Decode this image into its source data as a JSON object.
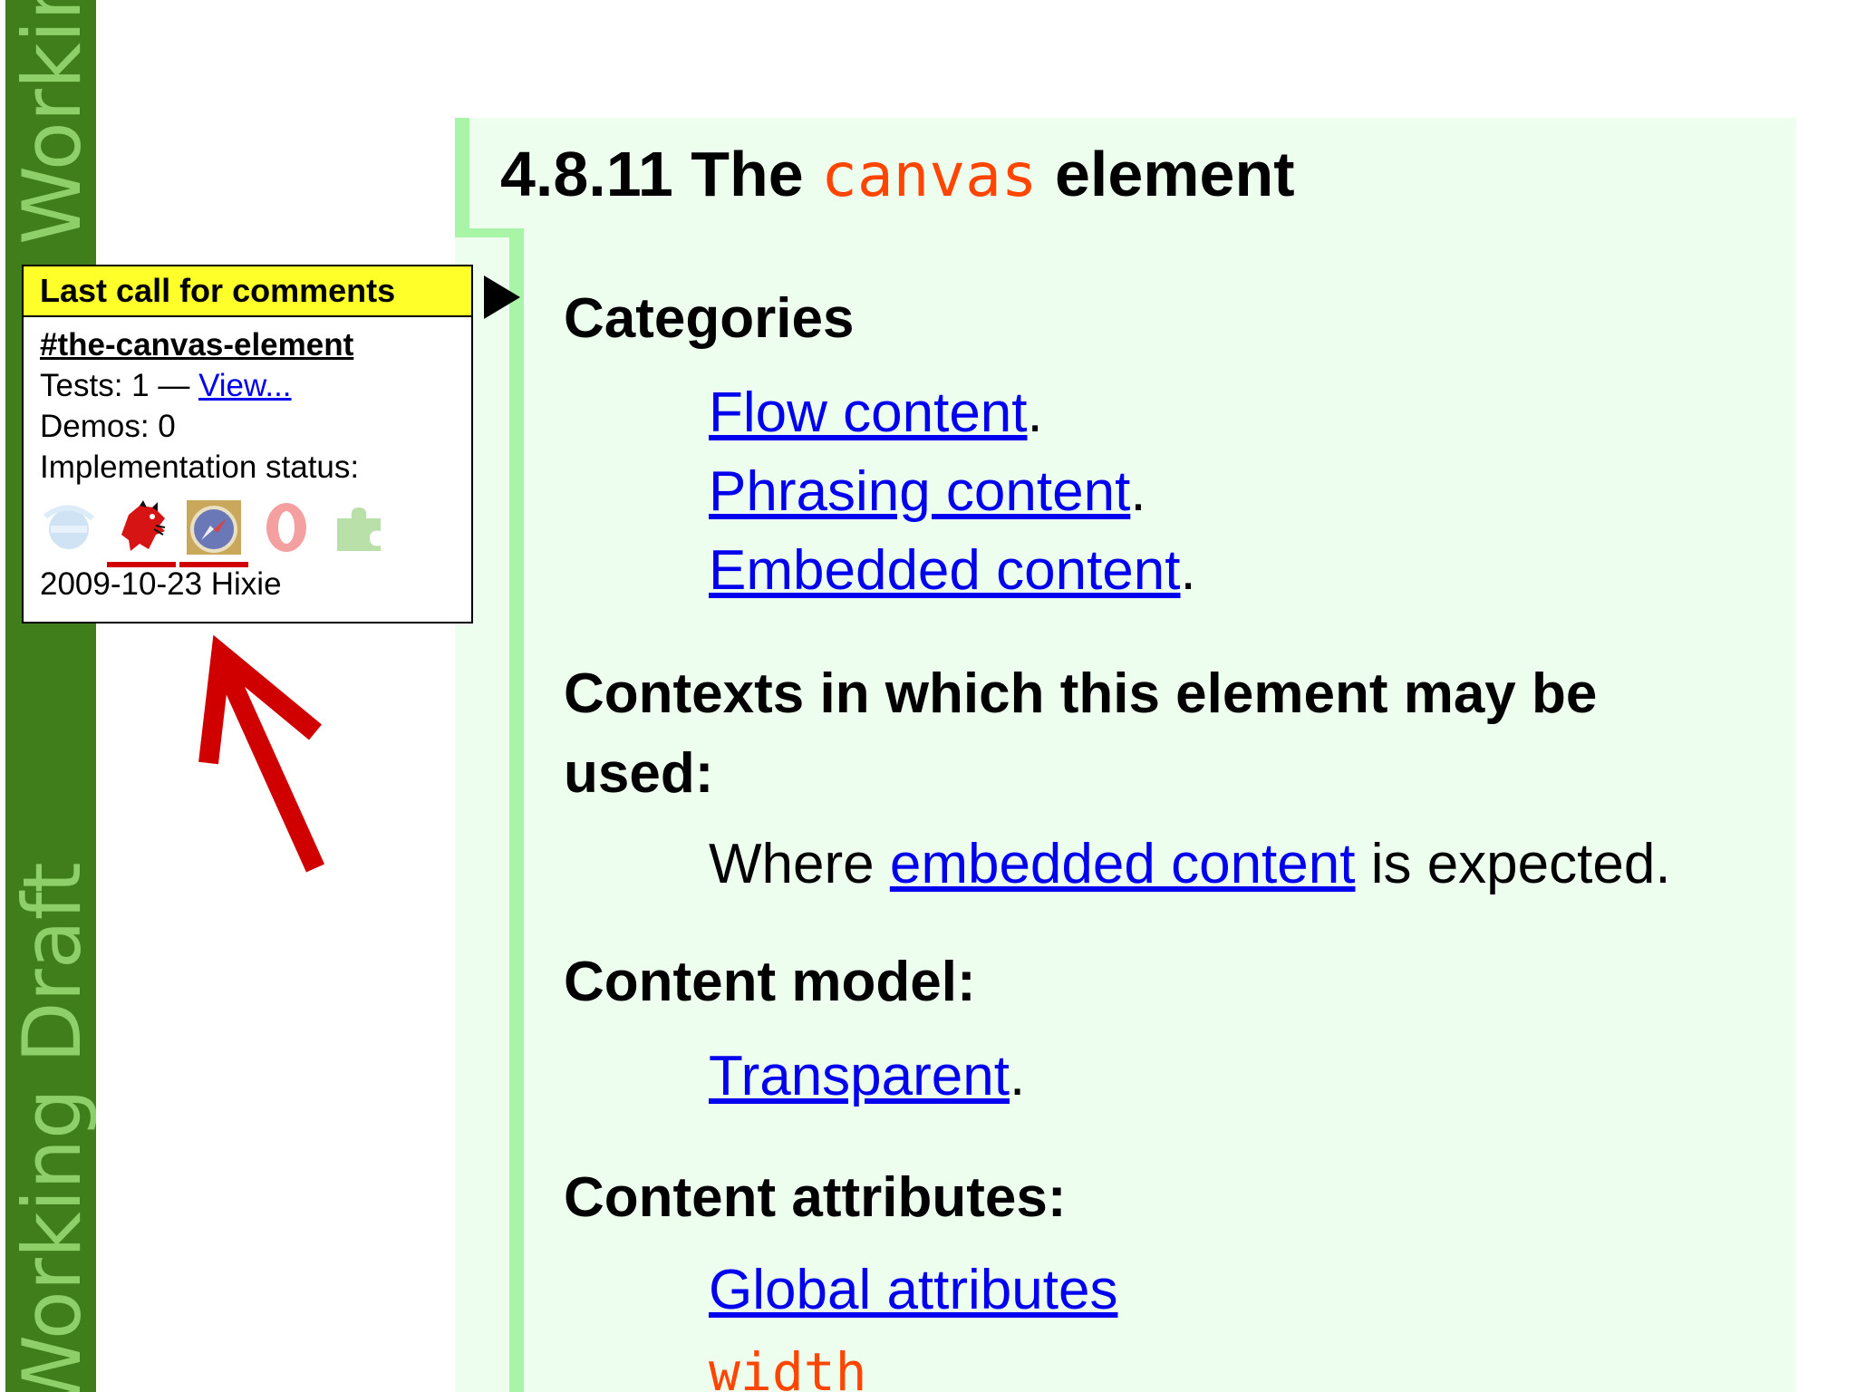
{
  "status_band": {
    "label_top": "Working Draft",
    "label_bottom": "Working Draft",
    "color": "#3f7e1a"
  },
  "section": {
    "number": "4.8.11",
    "title_pre": "The",
    "title_code": "canvas",
    "title_post": "element"
  },
  "categories": {
    "label": "Categories",
    "items": [
      "Flow content",
      "Phrasing content",
      "Embedded content"
    ]
  },
  "contexts": {
    "label_line1": "Contexts in which this element may be",
    "label_line2": "used:",
    "pre": "Where",
    "link": "embedded content",
    "post": "is expected."
  },
  "content_model": {
    "label": "Content model:",
    "value": "Transparent"
  },
  "content_attributes": {
    "label": "Content attributes:",
    "items": [
      "Global attributes",
      "width"
    ]
  },
  "popup": {
    "header": "Last call for comments",
    "anchor": "#the-canvas-element",
    "tests_label": "Tests: 1 —",
    "tests_link": "View...",
    "demos": "Demos: 0",
    "impl_status": "Implementation status:",
    "browsers": [
      {
        "icon": "ie-icon",
        "supported": false
      },
      {
        "icon": "firefox-icon",
        "supported": true
      },
      {
        "icon": "safari-icon",
        "supported": true
      },
      {
        "icon": "opera-icon",
        "supported": false
      },
      {
        "icon": "plugin-icon",
        "supported": false
      }
    ],
    "footer": "2009-10-23 Hixie"
  },
  "colors": {
    "link": "#0000ee",
    "code": "#ff4500",
    "section_bg": "#eefeee",
    "section_border": "#a8f5a8",
    "popup_header_bg": "#ffff2a",
    "annotation_arrow": "#d10000"
  }
}
